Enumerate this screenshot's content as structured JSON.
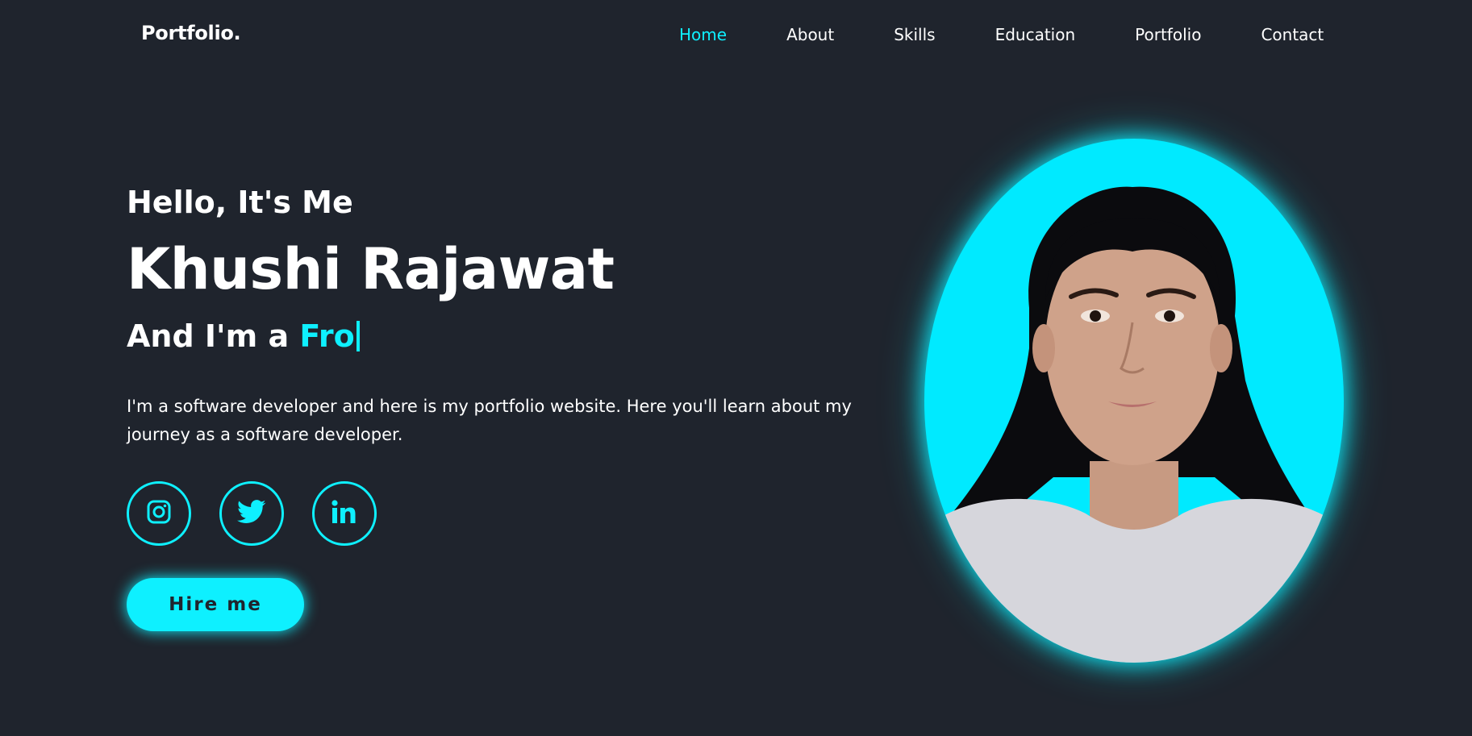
{
  "header": {
    "logo": "Portfolio.",
    "nav": [
      {
        "label": "Home",
        "active": true
      },
      {
        "label": "About",
        "active": false
      },
      {
        "label": "Skills",
        "active": false
      },
      {
        "label": "Education",
        "active": false
      },
      {
        "label": "Portfolio",
        "active": false
      },
      {
        "label": "Contact",
        "active": false
      }
    ]
  },
  "hero": {
    "greeting": "Hello, It's Me",
    "name": "Khushi Rajawat",
    "role_prefix": "And I'm a ",
    "role_typed": "Fro",
    "description": "I'm a software developer and here is my portfolio website. Here you'll learn about my journey as a software developer.",
    "social": [
      {
        "icon": "instagram-icon"
      },
      {
        "icon": "twitter-icon"
      },
      {
        "icon": "linkedin-icon"
      }
    ],
    "button_label": "Hire me"
  },
  "theme": {
    "background": "#1f242d",
    "accent": "#0ef0ff",
    "text": "#ffffff"
  }
}
